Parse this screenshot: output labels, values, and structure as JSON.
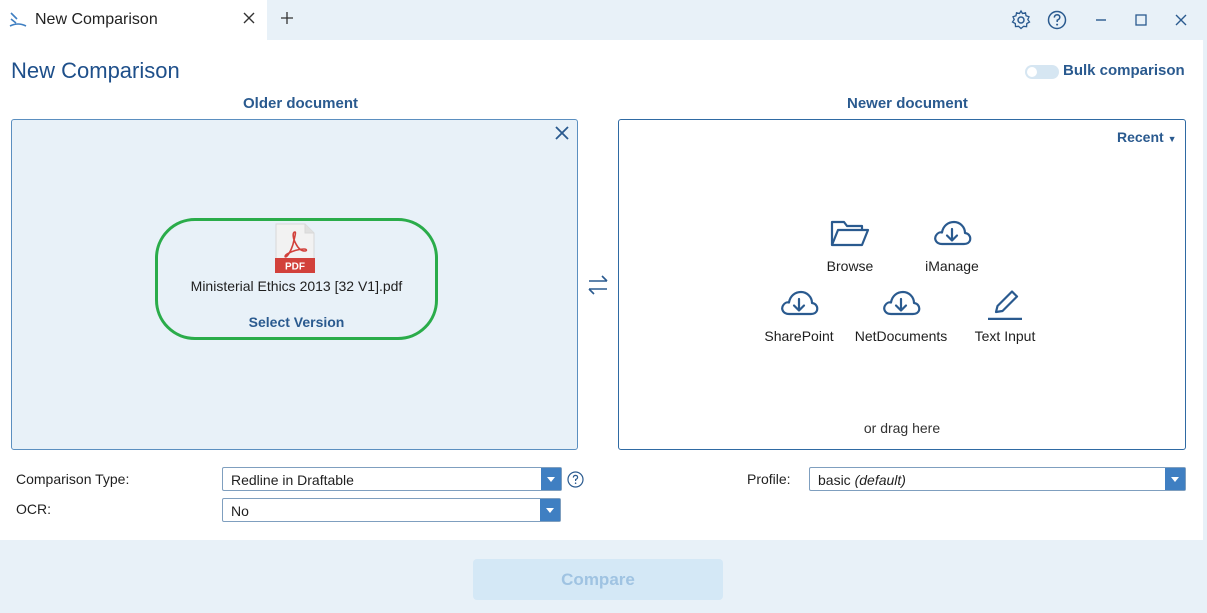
{
  "tab": {
    "title": "New Comparison"
  },
  "page": {
    "title": "New Comparison"
  },
  "bulk": {
    "label": "Bulk comparison",
    "enabled": false
  },
  "older": {
    "heading": "Older document",
    "file_name": "Ministerial Ethics 2013 [32 V1].pdf",
    "file_type_badge": "PDF",
    "select_version": "Select Version"
  },
  "newer": {
    "heading": "Newer document",
    "recent_label": "Recent",
    "sources": {
      "browse": "Browse",
      "imanage": "iManage",
      "sharepoint": "SharePoint",
      "netdocuments": "NetDocuments",
      "text_input": "Text Input"
    },
    "drag_text": "or drag here"
  },
  "form": {
    "comparison_type_label": "Comparison Type:",
    "comparison_type_value": "Redline in Draftable",
    "ocr_label": "OCR:",
    "ocr_value": "No",
    "profile_label": "Profile:",
    "profile_value": "basic",
    "profile_suffix": "(default)"
  },
  "footer": {
    "compare_label": "Compare"
  },
  "colors": {
    "accent": "#2a5a8f",
    "highlight": "#2aac4a",
    "panel_bg": "#e8f1f8",
    "pdf_red": "#d2413b"
  }
}
